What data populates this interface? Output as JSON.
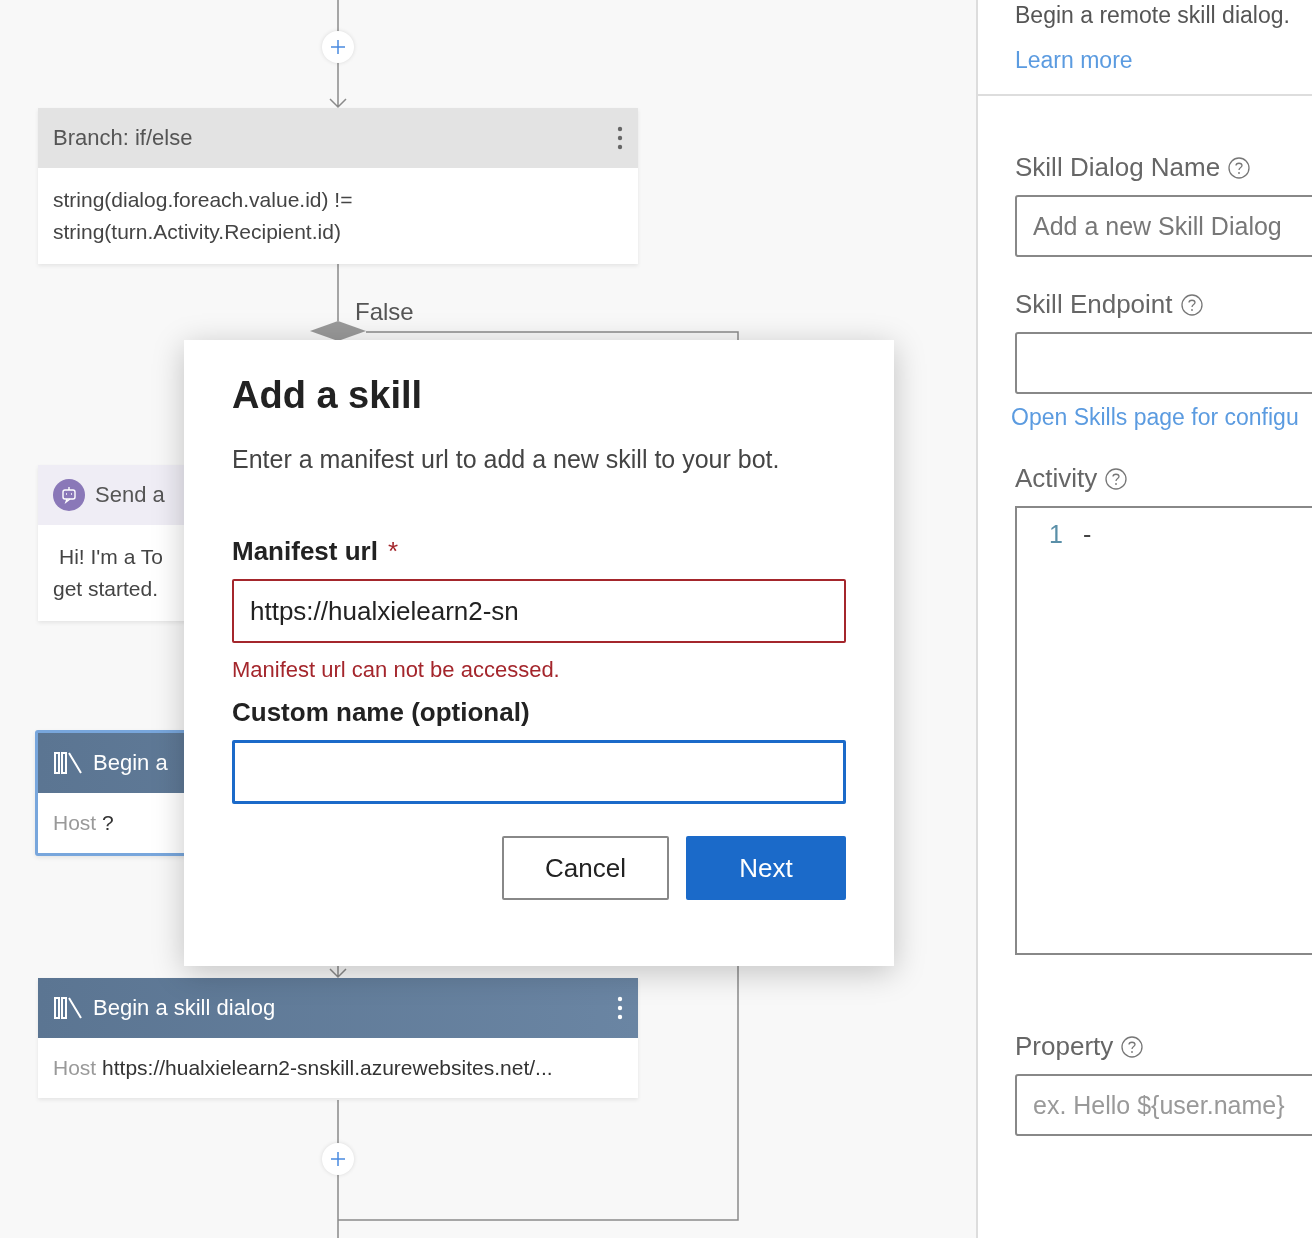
{
  "canvas": {
    "branch_label": "False",
    "nodes": [
      {
        "kind": "branch",
        "title": "Branch: if/else",
        "lines": [
          "string(dialog.foreach.value.id) !=",
          "string(turn.Activity.Recipient.id)"
        ],
        "selected": false,
        "more_button": true
      },
      {
        "kind": "send",
        "title": "Send a",
        "lines": [
          "Hi! I'm a To",
          "get started."
        ],
        "selected": false,
        "more_button": false
      },
      {
        "kind": "skill",
        "title": "Begin a",
        "host_label": "Host",
        "host_value": "?",
        "selected": true,
        "more_button": false
      },
      {
        "kind": "skill",
        "title": "Begin a skill dialog",
        "host_label": "Host",
        "host_value": "https://hualxielearn2-snskill.azurewebsites.net/...",
        "selected": false,
        "more_button": true
      }
    ]
  },
  "dialog": {
    "title": "Add a skill",
    "description": "Enter a manifest url to add a new skill to your bot.",
    "fields": [
      {
        "label": "Manifest url",
        "required_mark": "*",
        "value": "https://hualxielearn2-sn",
        "error": "Manifest url can not be accessed.",
        "invalid": true,
        "focused": false
      },
      {
        "label": "Custom name (optional)",
        "invalid": false,
        "focused": true
      }
    ],
    "buttons": [
      {
        "label": "Cancel",
        "primary": false
      },
      {
        "label": "Next",
        "primary": true
      }
    ]
  },
  "properties": {
    "description": "Begin a remote skill dialog.",
    "learn_more": "Learn more",
    "fields": [
      {
        "kind": "input",
        "label": "Skill Dialog Name",
        "placeholder": "Add a new Skill Dialog"
      },
      {
        "kind": "input",
        "label": "Skill Endpoint"
      },
      {
        "kind": "link",
        "text": "Open Skills page for configu"
      },
      {
        "kind": "editor",
        "label": "Activity",
        "line_number": "1",
        "code": "-"
      },
      {
        "kind": "input",
        "label": "Property",
        "placeholder": "ex. Hello ${user.name}"
      }
    ]
  }
}
